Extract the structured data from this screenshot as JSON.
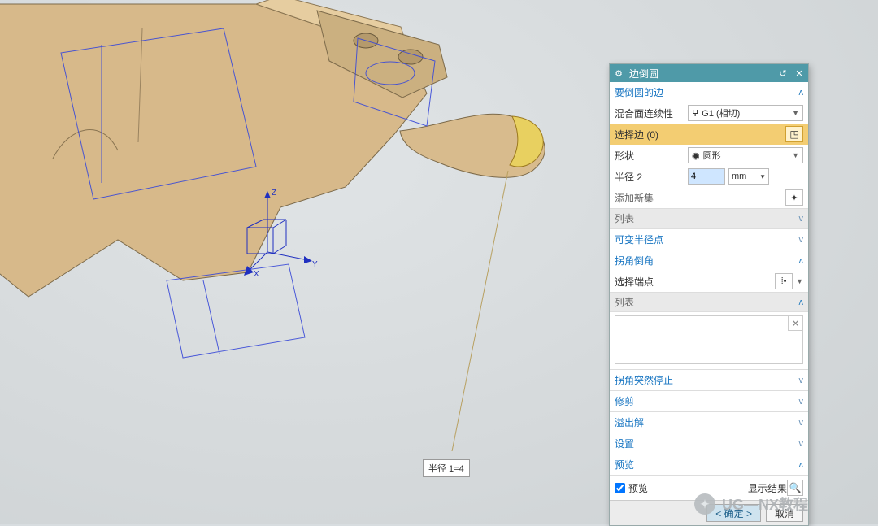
{
  "dialog": {
    "title": "边倒圆",
    "sections": {
      "edges": {
        "title": "要倒圆的边",
        "continuity_label": "混合面连续性",
        "continuity_value": "G1 (相切)",
        "select_edge_label": "选择边 (0)",
        "shape_label": "形状",
        "shape_value": "圆形",
        "radius_label": "半径 2",
        "radius_value": "4",
        "radius_unit": "mm",
        "add_set": "添加新集",
        "list_label": "列表"
      },
      "var_radius": {
        "title": "可变半径点"
      },
      "corner": {
        "title": "拐角倒角",
        "select_endpoint": "选择端点",
        "list_label": "列表"
      },
      "corner_stop": {
        "title": "拐角突然停止"
      },
      "trim": {
        "title": "修剪"
      },
      "overflow": {
        "title": "溢出解"
      },
      "settings": {
        "title": "设置"
      },
      "preview": {
        "title": "预览",
        "checkbox_label": "预览",
        "show_result": "显示结果"
      }
    },
    "buttons": {
      "ok": "< 确定 >",
      "cancel": "取消"
    }
  },
  "viewport": {
    "radius_annotation": "半径 1=4",
    "axes": {
      "x": "X",
      "y": "Y",
      "z": "Z"
    }
  },
  "watermark": "UG—NX教程"
}
